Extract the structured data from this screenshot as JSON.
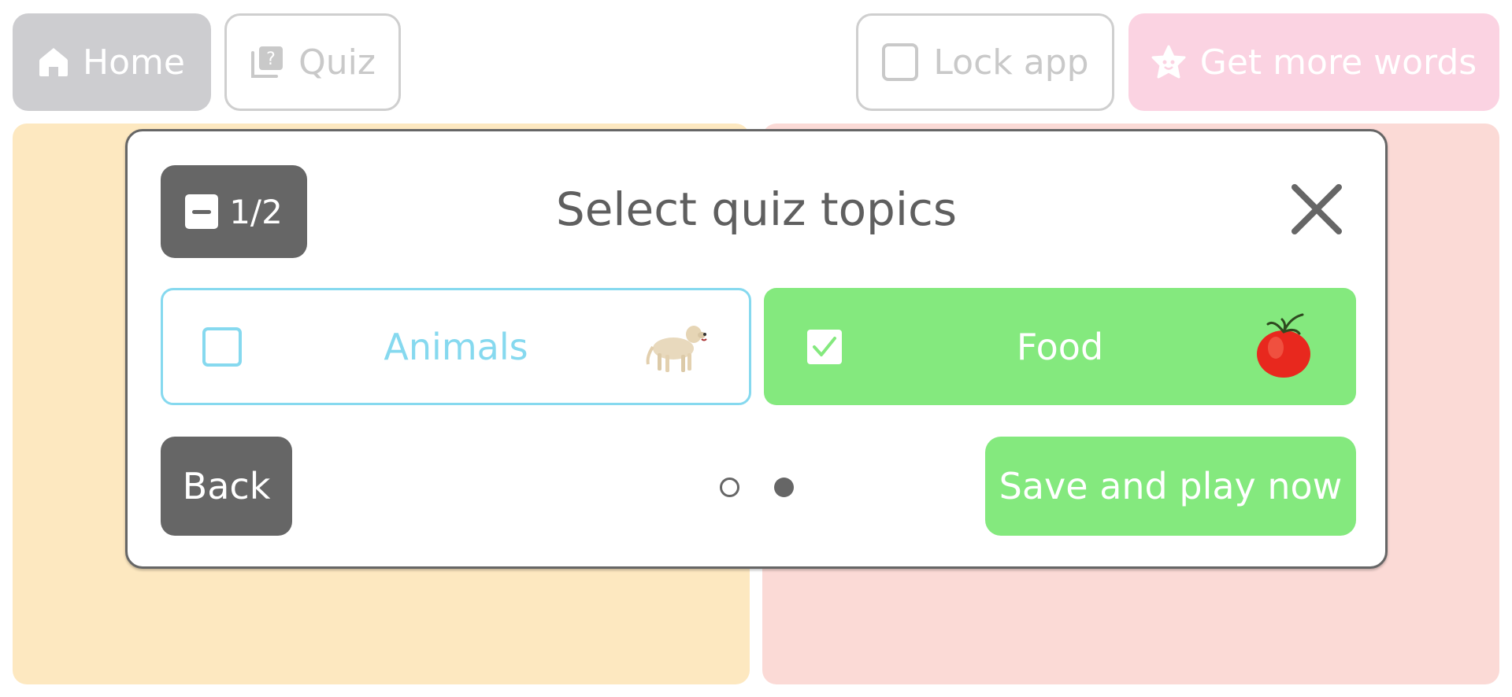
{
  "topbar": {
    "home_label": "Home",
    "quiz_label": "Quiz",
    "lock_label": "Lock app",
    "more_label": "Get more words"
  },
  "modal": {
    "counter": "1/2",
    "title": "Select quiz topics",
    "topics": [
      {
        "label": "Animals",
        "checked": false,
        "image": "dog"
      },
      {
        "label": "Food",
        "checked": true,
        "image": "tomato"
      }
    ],
    "back_label": "Back",
    "save_label": "Save and play now",
    "pagination": {
      "current_page": 2,
      "total_pages": 2
    }
  },
  "colors": {
    "accent_green": "#84e97e",
    "accent_blue": "#86d9ef",
    "dark_gray": "#666666",
    "panel_yellow": "#fde8c0",
    "panel_pink": "#fbdad6",
    "more_pink": "#fbd3e2"
  }
}
